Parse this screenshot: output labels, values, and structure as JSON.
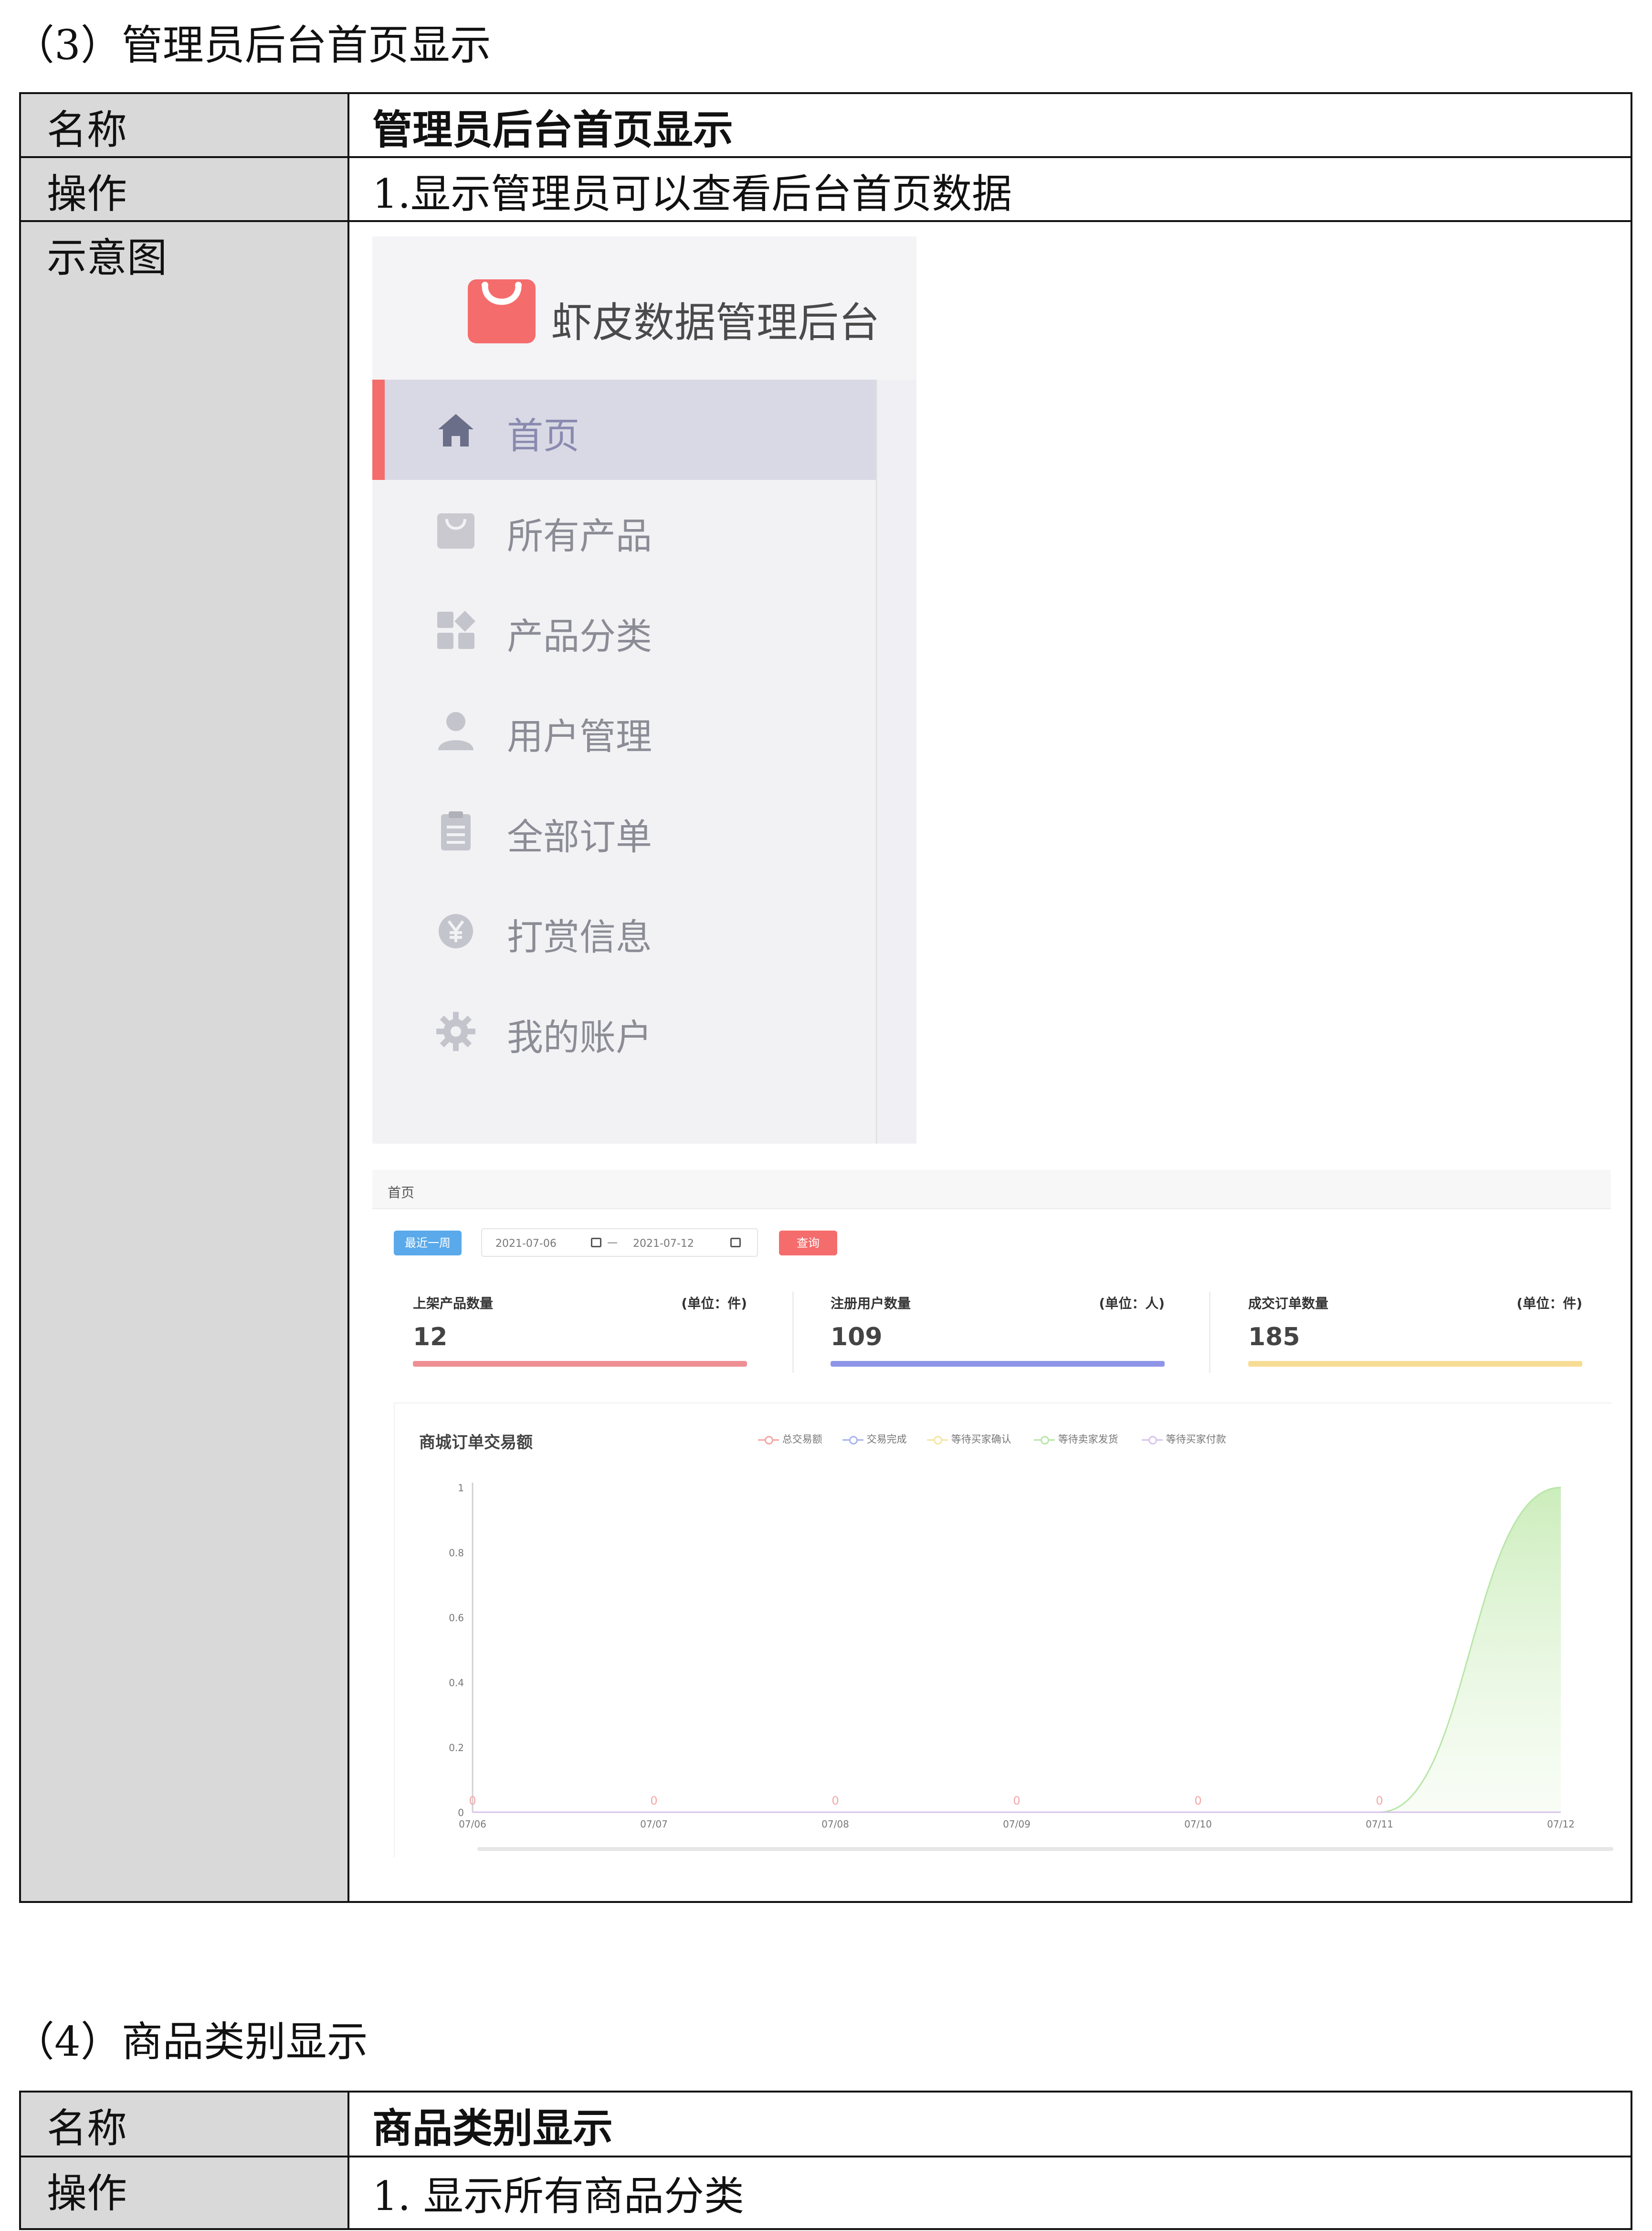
{
  "section3": {
    "heading": "（3）管理员后台首页显示",
    "rows": [
      {
        "label": "名称",
        "value": "管理员后台首页显示"
      },
      {
        "label": "操作",
        "value": "1.显示管理员可以查看后台首页数据"
      },
      {
        "label": "示意图",
        "value": ""
      }
    ]
  },
  "sidebar": {
    "brand": "虾皮数据管理后台",
    "items": [
      {
        "label": "首页",
        "icon": "home-icon",
        "active": true
      },
      {
        "label": "所有产品",
        "icon": "shopping-bag-icon"
      },
      {
        "label": "产品分类",
        "icon": "category-icon"
      },
      {
        "label": "用户管理",
        "icon": "user-icon"
      },
      {
        "label": "全部订单",
        "icon": "clipboard-icon"
      },
      {
        "label": "打赏信息",
        "icon": "yen-coin-icon"
      },
      {
        "label": "我的账户",
        "icon": "gear-icon"
      }
    ],
    "colors": {
      "accent": "#f56c6c",
      "active_bg": "#d8d9e4"
    }
  },
  "dashboard": {
    "breadcrumb": "首页",
    "filter": {
      "recent_week": "最近一周",
      "start": "2021-07-06",
      "sep": "—",
      "end": "2021-07-12",
      "query": "查询"
    },
    "stats": [
      {
        "title": "上架产品数量",
        "unit": "(单位：件)",
        "value": "12",
        "color": "#ef8f94"
      },
      {
        "title": "注册用户数量",
        "unit": "(单位：人)",
        "value": "109",
        "color": "#8e95e8"
      },
      {
        "title": "成交订单数量",
        "unit": "(单位：件)",
        "value": "185",
        "color": "#f6dc95"
      }
    ]
  },
  "chart_data": {
    "type": "area",
    "title": "商城订单交易额",
    "x": [
      "07/06",
      "07/07",
      "07/08",
      "07/09",
      "07/10",
      "07/11",
      "07/12"
    ],
    "ylim": [
      0,
      1
    ],
    "yticks": [
      "0",
      "0.2",
      "0.4",
      "0.6",
      "0.8",
      "1"
    ],
    "series": [
      {
        "name": "总交易额",
        "color": "#f4a6a6",
        "values": [
          0,
          0,
          0,
          0,
          0,
          0,
          0
        ],
        "labels": [
          "0",
          "0",
          "0",
          "0",
          "0",
          "0",
          ""
        ]
      },
      {
        "name": "交易完成",
        "color": "#a8b4ec",
        "values": [
          0,
          0,
          0,
          0,
          0,
          0,
          0
        ]
      },
      {
        "name": "等待买家确认",
        "color": "#f5e6a0",
        "values": [
          0,
          0,
          0,
          0,
          0,
          0,
          0
        ]
      },
      {
        "name": "等待卖家发货",
        "color": "#b8e6a8",
        "values": [
          0,
          0,
          0,
          0,
          0,
          0,
          1
        ]
      },
      {
        "name": "等待买家付款",
        "color": "#d7c4ec",
        "values": [
          0,
          0,
          0,
          0,
          0,
          0,
          0
        ]
      }
    ],
    "legend": "top",
    "grid": false
  },
  "section4": {
    "heading": "（4）商品类别显示",
    "rows": [
      {
        "label": "名称",
        "value": "商品类别显示"
      },
      {
        "label": "操作",
        "value": "1.  显示所有商品分类"
      }
    ]
  }
}
